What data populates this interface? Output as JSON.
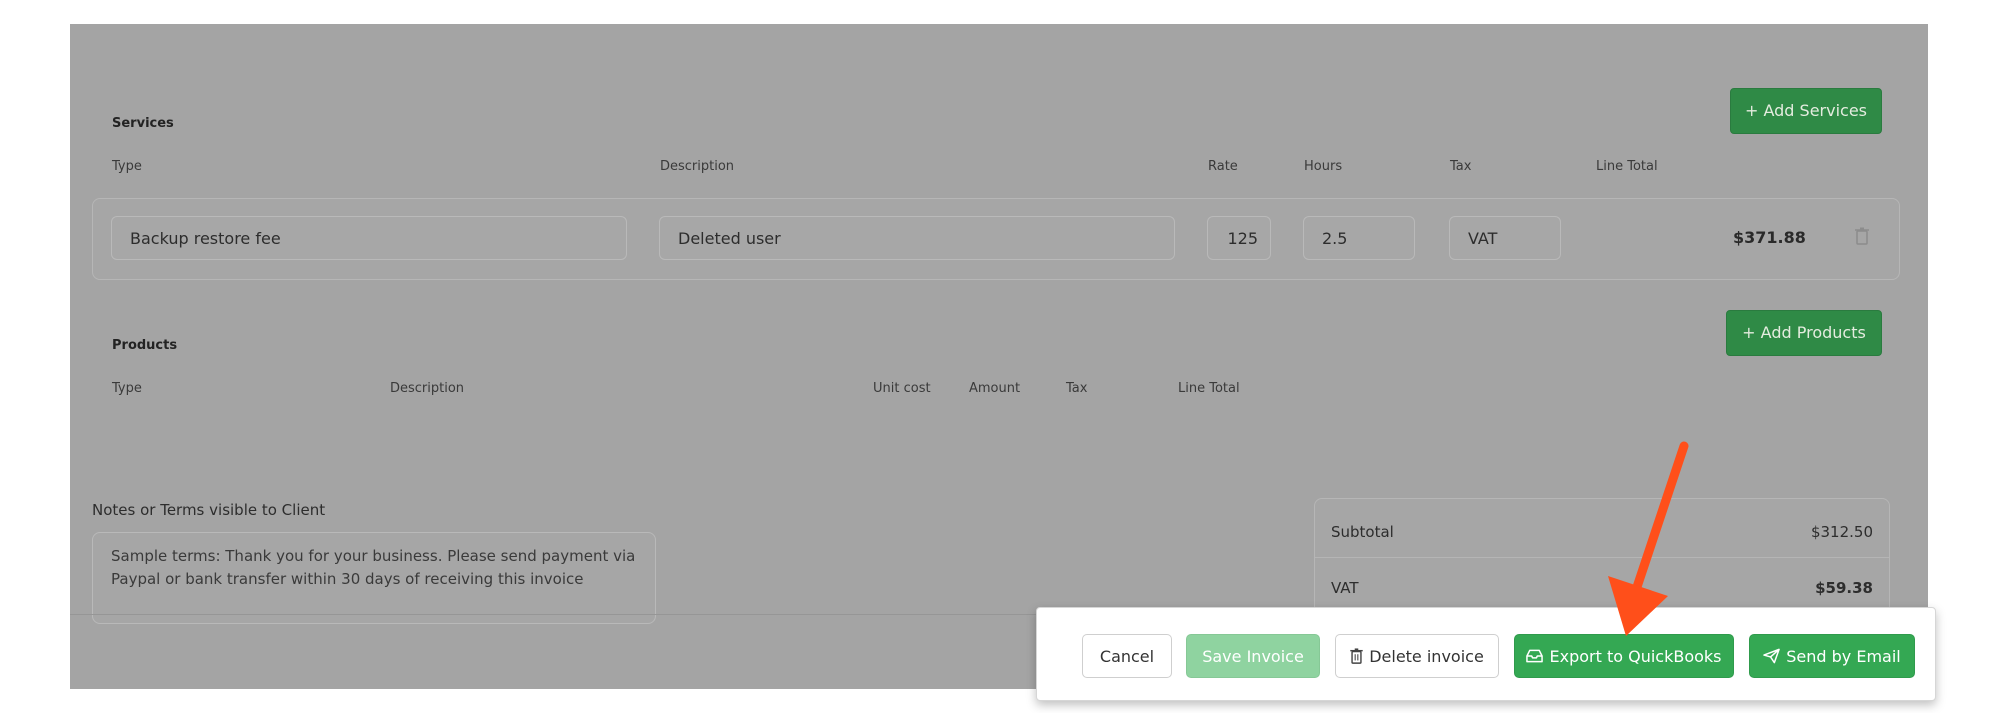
{
  "services": {
    "title": "Services",
    "add_button": "+ Add Services",
    "columns": {
      "type": "Type",
      "description": "Description",
      "rate": "Rate",
      "hours": "Hours",
      "tax": "Tax",
      "line_total": "Line Total"
    },
    "row": {
      "type": "Backup restore fee",
      "description": "Deleted user",
      "rate": "125",
      "hours": "2.5",
      "tax": "VAT",
      "line_total": "$371.88"
    }
  },
  "products": {
    "title": "Products",
    "add_button": "+ Add Products",
    "columns": {
      "type": "Type",
      "description": "Description",
      "unit_cost": "Unit cost",
      "amount": "Amount",
      "tax": "Tax",
      "line_total": "Line Total"
    }
  },
  "notes": {
    "label": "Notes or Terms visible to Client",
    "text": "Sample terms: Thank you for your business. Please send payment via Paypal or bank transfer within 30 days of receiving this invoice"
  },
  "totals": {
    "subtotal_label": "Subtotal",
    "subtotal_value": "$312.50",
    "vat_label": "VAT",
    "vat_value": "$59.38"
  },
  "actions": {
    "cancel": "Cancel",
    "save": "Save Invoice",
    "delete": "Delete invoice",
    "export": "Export to QuickBooks",
    "send": "Send by Email"
  },
  "colors": {
    "primary_green": "#34a853",
    "arrow": "#ff4f1a"
  }
}
